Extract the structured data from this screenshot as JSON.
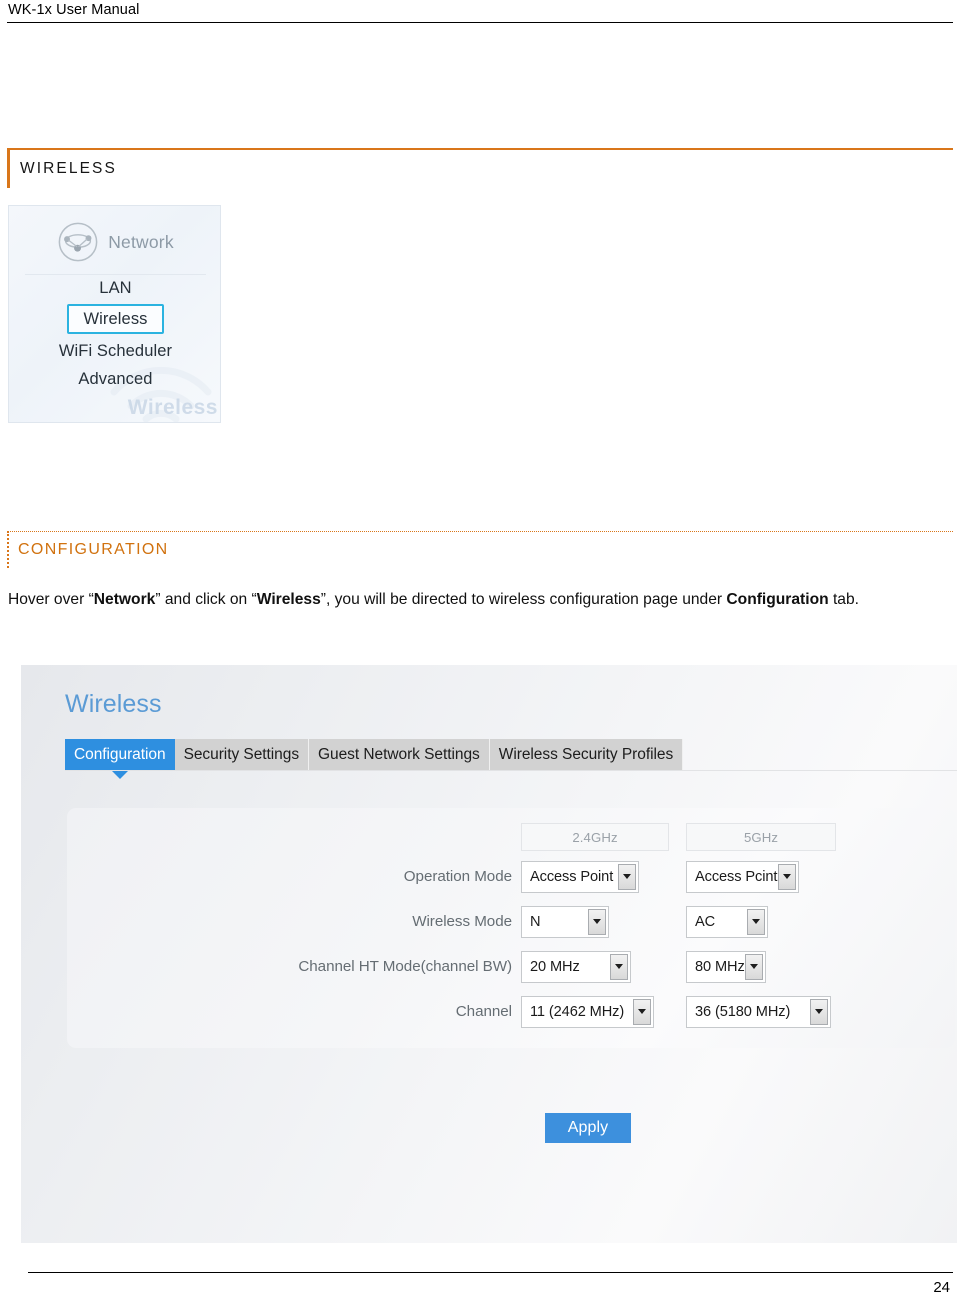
{
  "document": {
    "running_header": "WK-1x User Manual",
    "page_number": "24"
  },
  "sections": {
    "wireless_heading": "WIRELESS",
    "configuration_heading": "CONFIGURATION",
    "paragraph": {
      "part1": "Hover over “",
      "bold1": "Network",
      "part2": "” and click on “",
      "bold2": "Wireless",
      "part3": "”, you will be directed to wireless configuration page under ",
      "bold3": "Configuration",
      "part4": " tab."
    }
  },
  "menu_screenshot": {
    "icon": "network-globe-icon",
    "title": "Network",
    "items": [
      {
        "label": "LAN",
        "active": false
      },
      {
        "label": "Wireless",
        "active": true
      },
      {
        "label": "WiFi Scheduler",
        "active": false
      },
      {
        "label": "Advanced",
        "active": false
      }
    ],
    "watermark_text": "Wireless",
    "highlight_color": "#2bb3e0"
  },
  "ui_panel": {
    "title": "Wireless",
    "title_color": "#5b9bd5",
    "active_tab_color": "#2e8fe0",
    "tabs": [
      {
        "label": "Configuration",
        "active": true
      },
      {
        "label": "Security Settings",
        "active": false
      },
      {
        "label": "Guest Network Settings",
        "active": false
      },
      {
        "label": "Wireless Security Profiles",
        "active": false
      }
    ],
    "bands": {
      "band_a": "2.4GHz",
      "band_b": "5GHz"
    },
    "rows": [
      {
        "label": "Operation Mode",
        "value_a": "Access Point",
        "value_b": "Access Pcint"
      },
      {
        "label": "Wireless Mode",
        "value_a": "N",
        "value_b": "AC"
      },
      {
        "label": "Channel HT Mode(channel BW)",
        "value_a": "20 MHz",
        "value_b": "80 MHz"
      },
      {
        "label": "Channel",
        "value_a": "11 (2462 MHz)",
        "value_b": "36 (5180 MHz)"
      }
    ],
    "apply_label": "Apply",
    "apply_color": "#3d90dd"
  }
}
